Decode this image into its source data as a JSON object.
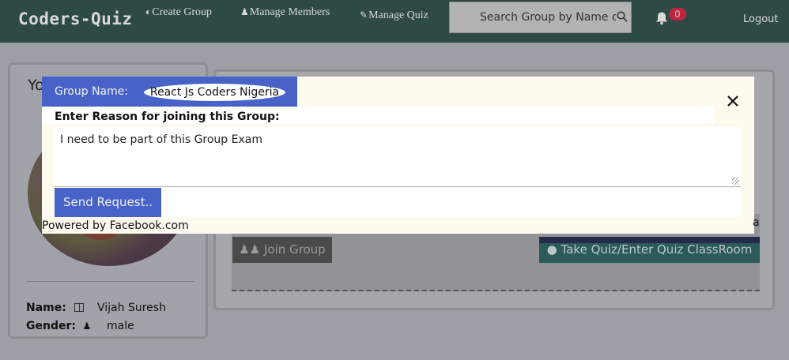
{
  "navbar": {
    "brand": "Coders-Quiz",
    "links": [
      {
        "icon": "globe-icon",
        "label": "Create Group"
      },
      {
        "icon": "user-icon",
        "label": "Manage Members"
      },
      {
        "icon": "pencil-icon",
        "label": "Manage Quiz"
      }
    ],
    "search_placeholder": "Search Group by Name or",
    "notification_count": "0",
    "logout": "Logout"
  },
  "profile": {
    "title_partial": "Yo",
    "name_label": "Name:",
    "name_value": "Vijah Suresh",
    "gender_label": "Gender:",
    "gender_value": "male"
  },
  "group_card": {
    "join_button": "Join Group",
    "quiz_button": "Take Quiz/Enter Quiz ClassRoom",
    "edge_partial": "a"
  },
  "modal": {
    "group_name_label": "Group Name:",
    "group_name_value": "React Js Coders Nigeria",
    "reason_label": "Enter Reason for joining this Group:",
    "reason_value": "I need to be part of this Group Exam",
    "send_button": "Send Request..",
    "powered_by": "Powered by Facebook.com",
    "close_symbol": "✕"
  },
  "colors": {
    "navbar": "#2d4a45",
    "modal_accent": "#4763c8",
    "badge": "#c0253f",
    "quiz_button": "#2c5a58"
  }
}
